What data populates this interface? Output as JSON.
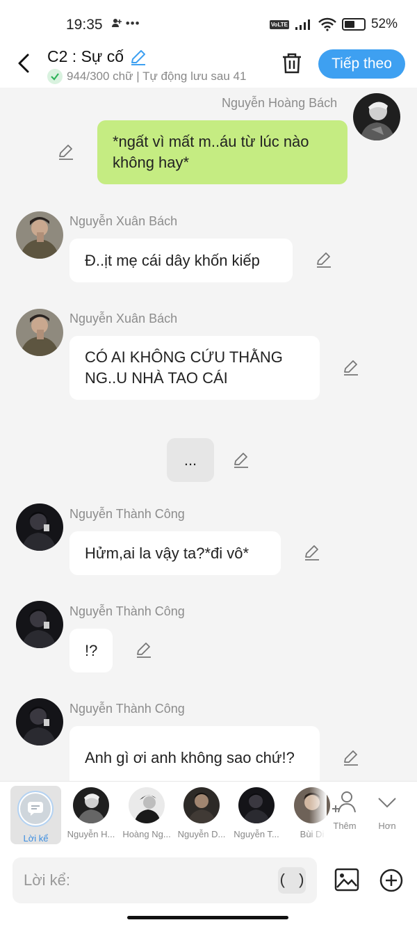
{
  "status": {
    "time": "19:35",
    "battery": "52%",
    "battery_level": 0.52,
    "network": "VoLTE"
  },
  "header": {
    "title": "C2 : Sự cố",
    "subtitle": "944/300 chữ | Tự động lưu sau 41",
    "next_label": "Tiếp theo"
  },
  "messages": [
    {
      "name": "Nguyễn Hoàng Bách",
      "text": "*ngất vì mất m..áu từ lúc nào không hay*"
    },
    {
      "name": "Nguyễn Xuân Bách",
      "text": "Đ..ịt mẹ cái dây khốn kiếp"
    },
    {
      "name": "Nguyễn Xuân Bách",
      "text": "CÓ AI KHÔNG CỨU THẰNG NG..U NHÀ TAO CÁI"
    },
    {
      "text": "..."
    },
    {
      "name": "Nguyễn Thành Công",
      "text": "Hửm,ai la vậy ta?*đi vô*"
    },
    {
      "name": "Nguyễn Thành Công",
      "text": "!?"
    },
    {
      "name": "Nguyễn Thành Công",
      "text": "Anh gì ơi anh không sao chứ!?"
    }
  ],
  "characters": {
    "narrator": "Lời kể",
    "list": [
      "Nguyễn H...",
      "Hoàng Ng...",
      "Nguyễn D...",
      "Nguyễn T...",
      "Bùi Di"
    ],
    "add_label": "Thêm",
    "more_label": "Hơn"
  },
  "input": {
    "placeholder": "Lời kể:",
    "paren_label": "( )"
  },
  "colors": {
    "accent": "#3ea0f1",
    "mine_bubble": "#c5ec82",
    "check": "#2fb35a"
  }
}
